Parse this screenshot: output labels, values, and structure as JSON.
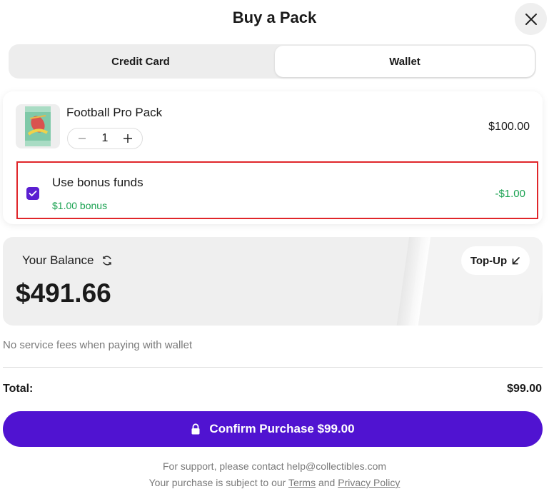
{
  "header": {
    "title": "Buy a Pack",
    "close_icon": "close-icon"
  },
  "tabs": {
    "items": [
      {
        "label": "Credit Card",
        "selected": false
      },
      {
        "label": "Wallet",
        "selected": true
      }
    ]
  },
  "product": {
    "name": "Football Pro Pack",
    "quantity": "1",
    "price": "$100.00",
    "image_icon": "pack-image"
  },
  "bonus": {
    "label": "Use bonus funds",
    "sub_label": "$1.00 bonus",
    "amount": "-$1.00",
    "checked": true
  },
  "balance": {
    "label": "Your Balance",
    "value": "$491.66",
    "topup_label": "Top-Up"
  },
  "fee_note": "No service fees when paying with wallet",
  "total": {
    "label": "Total:",
    "value": "$99.00"
  },
  "confirm": {
    "label": "Confirm Purchase $99.00"
  },
  "support": {
    "line1": "For support, please contact help@collectibles.com",
    "line2_prefix": "Your purchase is subject to our",
    "terms_link": "Terms",
    "and": "and",
    "privacy_link": "Privacy Policy"
  },
  "colors": {
    "accent": "#5013d1",
    "bonus_green": "#1aa251",
    "highlight_red": "#e0262a"
  }
}
